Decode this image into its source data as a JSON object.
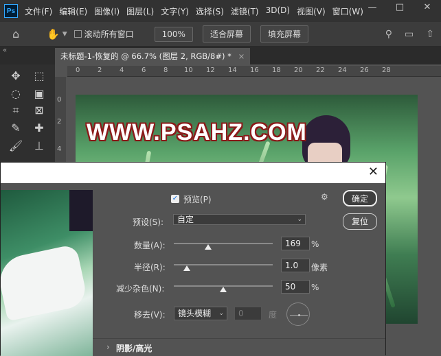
{
  "app": {
    "logo": "Ps"
  },
  "menu": [
    "文件(F)",
    "编辑(E)",
    "图像(I)",
    "图层(L)",
    "文字(Y)",
    "选择(S)",
    "滤镜(T)",
    "3D(D)",
    "视图(V)",
    "窗口(W)"
  ],
  "window_controls": {
    "minimize": "—",
    "maximize": "□",
    "close": "✕"
  },
  "options": {
    "scroll_all_label": "滚动所有窗口",
    "zoom": "100%",
    "fit_screen": "适合屏幕",
    "fill_screen": "填充屏幕"
  },
  "document": {
    "tab_title": "未标题-1-恢复的 @ 66.7% (图层 2, RGB/8#) *",
    "tab_close": "×"
  },
  "ruler": {
    "h_ticks": [
      "0",
      "2",
      "4",
      "6",
      "8",
      "10",
      "12",
      "14",
      "16",
      "18",
      "20",
      "22",
      "24",
      "26",
      "28"
    ],
    "v_ticks": [
      "0",
      "2",
      "4"
    ]
  },
  "canvas": {
    "watermark": "WWW.PSAHZ.COM"
  },
  "dialog": {
    "close": "✕",
    "preview_label": "预览(P)",
    "preview_checked": true,
    "preset_label": "预设(S):",
    "preset_value": "自定",
    "amount_label": "数量(A):",
    "amount_value": "169",
    "amount_unit": "%",
    "amount_fraction": 0.35,
    "radius_label": "半径(R):",
    "radius_value": "1.0",
    "radius_unit": "像素",
    "radius_fraction": 0.13,
    "noise_label": "减少杂色(N):",
    "noise_value": "50",
    "noise_unit": "%",
    "noise_fraction": 0.5,
    "remove_label": "移去(V):",
    "remove_value": "镜头模糊",
    "angle_value": "0",
    "angle_unit": "度",
    "ok_label": "确定",
    "reset_label": "复位",
    "shadow_section": "阴影/高光"
  }
}
